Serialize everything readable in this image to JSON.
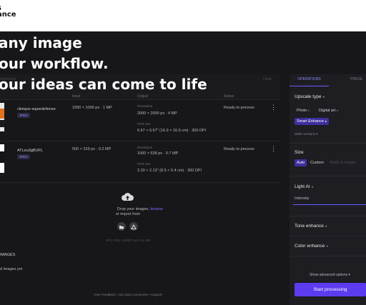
{
  "brand": {
    "logo_line1": "s",
    "logo_line2": "ance"
  },
  "hero": {
    "line1": "any image",
    "line2": "our workflow.",
    "line3": "our ideas can come to life"
  },
  "toolbar": {
    "queue_label": "PROCESS",
    "clear_label": "Clear"
  },
  "table": {
    "headers": {
      "input": "Input",
      "output": "Output",
      "status": "Status"
    },
    "rows": [
      {
        "filename": "clinique-superdefense",
        "type": "JPEG",
        "input": "1000 × 1000 px · 1 MP",
        "output_resolution_label": "Resolution",
        "output_resolution": "2000 × 2000 px · 4 MP",
        "output_print_label": "Print size",
        "output_print": "6.67 × 6.67\" (16.9 × 16.9 cm) · 300 DPI",
        "status": "Ready to process"
      },
      {
        "filename": "ATLeu3gBUFL",
        "type": "JPEG",
        "input": "500 × 319 px · 0.2 MP",
        "output_resolution_label": "Resolution",
        "output_resolution": "1000 × 638 px · 0.7 MP",
        "output_print_label": "Print size",
        "output_print": "3.33 × 2.13\" (8.5 × 5.4 cm) · 300 DPI",
        "status": "Ready to process"
      }
    ]
  },
  "dropzone": {
    "line1_prefix": "Drop your images, ",
    "browse_link": "browse",
    "line2": "or import from",
    "formats": "JPG, PNG, WEBP up to 32 MB"
  },
  "recent": {
    "title": "IMAGES",
    "empty": "d images yet"
  },
  "footer": "Give Feedback  •  Join beta community  •  Support",
  "panel": {
    "tabs": [
      "OPERATIONS",
      "PRESE"
    ],
    "upscale_type": {
      "title": "Upscale type",
      "options": [
        "Photo",
        "Digital art",
        "Smart Enhance"
      ],
      "selected": "Smart Enhance",
      "older_versions": "Older versions"
    },
    "size": {
      "title": "Size",
      "options": [
        "Auto",
        "Custom",
        "Width & Height"
      ],
      "selected": "Auto"
    },
    "light_ai": {
      "title": "Light AI",
      "intensity_label": "Intensity"
    },
    "tone_enhance": {
      "title": "Tone enhance"
    },
    "color_enhance": {
      "title": "Color enhance"
    },
    "advanced": "Show advanced options",
    "start_button": "Start processing"
  },
  "colors": {
    "accent": "#5d3bf0",
    "link": "#7b6cff",
    "panel_bg": "#1d1d22"
  },
  "icons": [
    "cloud-upload-icon",
    "folder-icon",
    "drive-icon",
    "kebab-menu-icon",
    "info-icon",
    "chevron-down-icon"
  ]
}
